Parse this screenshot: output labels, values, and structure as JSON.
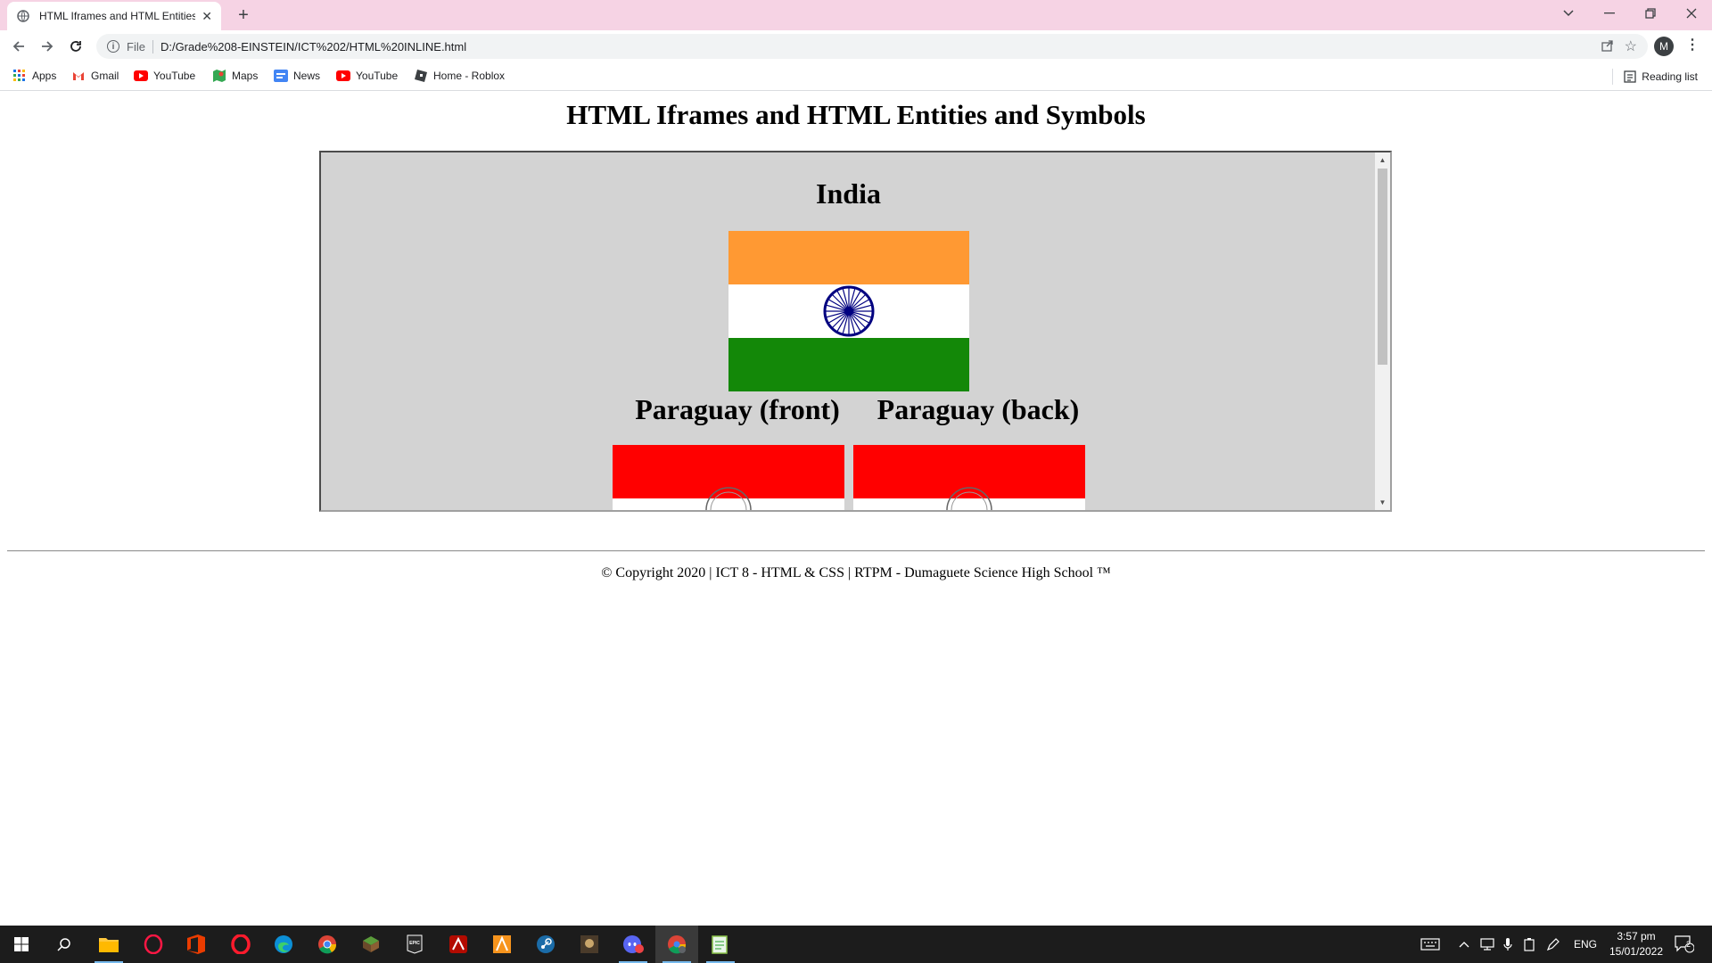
{
  "browser": {
    "tab_title": "HTML Iframes and HTML Entities",
    "tab_close": "✕",
    "new_tab": "+",
    "url_scheme": "File",
    "url": "D:/Grade%208-EINSTEIN/ICT%202/HTML%20INLINE.html",
    "avatar_letter": "M",
    "bookmarks": [
      {
        "label": "Apps",
        "icon": "apps-grid-icon"
      },
      {
        "label": "Gmail",
        "icon": "gmail-icon"
      },
      {
        "label": "YouTube",
        "icon": "youtube-icon"
      },
      {
        "label": "Maps",
        "icon": "maps-icon"
      },
      {
        "label": "News",
        "icon": "news-icon"
      },
      {
        "label": "YouTube",
        "icon": "youtube-icon"
      },
      {
        "label": "Home - Roblox",
        "icon": "roblox-icon"
      }
    ],
    "reading_list": "Reading list"
  },
  "page": {
    "title": "HTML Iframes and HTML Entities and Symbols",
    "iframe": {
      "india": "India",
      "paraguay_front": "Paraguay (front)",
      "paraguay_back": "Paraguay (back)"
    },
    "footer": "© Copyright 2020 | ICT 8 - HTML & CSS | RTPM - Dumaguete Science High School ™"
  },
  "taskbar": {
    "language": "ENG",
    "time": "3:57 pm",
    "date": "15/01/2022",
    "notification_count": "2"
  },
  "colors": {
    "tab_bar": "#f6d3e4",
    "iframe_bg": "#d3d3d3",
    "india_saffron": "#ff9933",
    "india_green": "#138808",
    "india_chakra": "#000080",
    "paraguay_red": "#ff0000"
  }
}
